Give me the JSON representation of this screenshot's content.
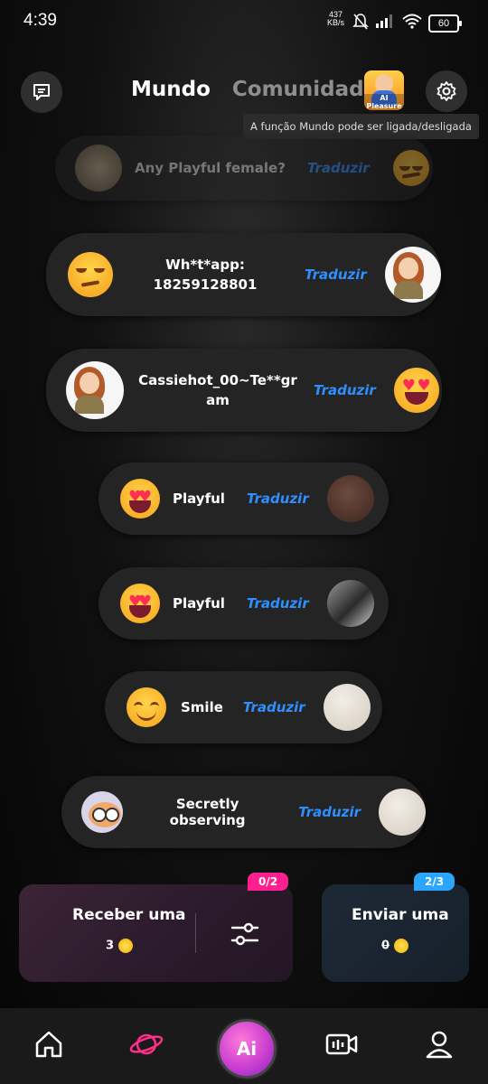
{
  "status_bar": {
    "time": "4:39",
    "net_speed": "437",
    "net_unit": "KB/s",
    "battery": "60"
  },
  "header": {
    "tabs": [
      {
        "label": "Mundo",
        "active": true
      },
      {
        "label": "Comunidade",
        "active": false
      }
    ],
    "ai_badge_label": "AI Pleasure",
    "tooltip": "A função Mundo pode ser ligada/desligada"
  },
  "bubbles": [
    {
      "text": "Any Playful female?",
      "translate": "Traduzir"
    },
    {
      "text": "Wh*t*app: 18259128801",
      "translate": "Traduzir"
    },
    {
      "text": "Cassiehot_00~Te**gram",
      "translate": "Traduzir"
    },
    {
      "text": "Playful",
      "translate": "Traduzir"
    },
    {
      "text": "Playful",
      "translate": "Traduzir"
    },
    {
      "text": "Smile",
      "translate": "Traduzir"
    },
    {
      "text": "Secretly observing",
      "translate": "Traduzir"
    }
  ],
  "cards": {
    "receive": {
      "label": "Receber uma",
      "count": "3",
      "badge": "0/2",
      "badge_color": "#ff1f8f"
    },
    "send": {
      "label": "Enviar uma",
      "count": "0",
      "badge": "2/3",
      "badge_color": "#2aa6ff"
    }
  },
  "nav": {
    "ai_label": "Ai",
    "accent": "#ff2e8a"
  }
}
